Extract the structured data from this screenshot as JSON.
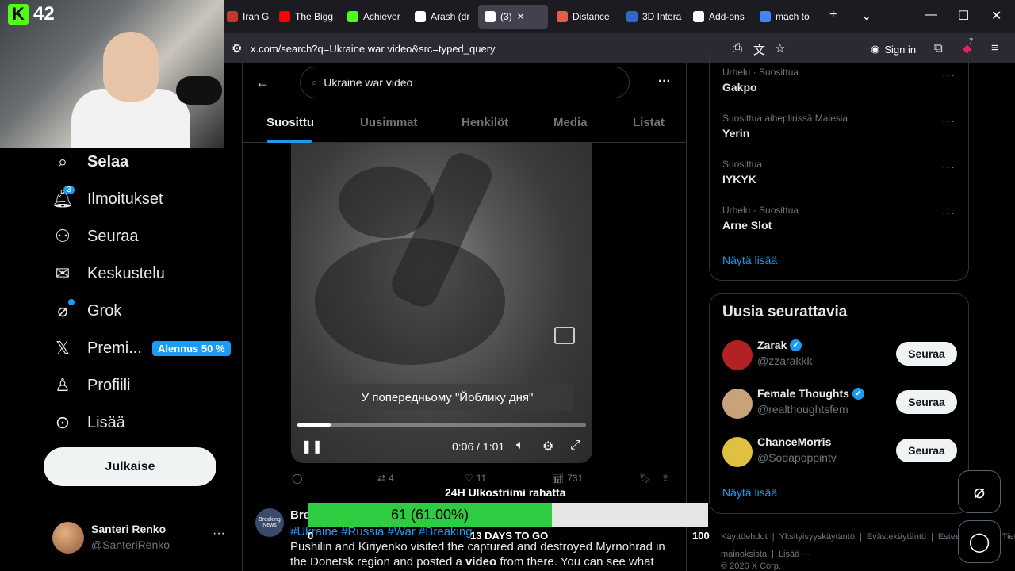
{
  "browser": {
    "tabs": [
      {
        "label": "Iran Guar",
        "color": "#c0392b"
      },
      {
        "label": "The Bigg",
        "color": "#ff0000"
      },
      {
        "label": "Achiever",
        "color": "#53fc18"
      },
      {
        "label": "Arash (dr",
        "color": "#ffffff"
      },
      {
        "label": "(3)",
        "color": "#ffffff"
      },
      {
        "label": "Distance",
        "color": "#e55b4d"
      },
      {
        "label": "3D Intera",
        "color": "#3366cc"
      },
      {
        "label": "Add-ons",
        "color": "#fbfbfe"
      },
      {
        "label": "mach to",
        "color": "#4285f4"
      }
    ],
    "url": "x.com/search?q=Ukraine war video&src=typed_query",
    "sign_in": "Sign in",
    "extension_badge": "7"
  },
  "stream": {
    "viewer_count": "42",
    "kick_letter": "K"
  },
  "nav": {
    "items": [
      {
        "label": "Selaa",
        "icon": "search-icon"
      },
      {
        "label": "Ilmoitukset",
        "icon": "bell-icon",
        "badge": "3"
      },
      {
        "label": "Seuraa",
        "icon": "add-person-icon"
      },
      {
        "label": "Keskustelu",
        "icon": "mail-icon"
      },
      {
        "label": "Grok",
        "icon": "grok-icon"
      },
      {
        "label": "Premi...",
        "icon": "x-logo-icon"
      },
      {
        "label": "Profiili",
        "icon": "person-icon"
      },
      {
        "label": "Lisää",
        "icon": "more-circle-icon"
      }
    ],
    "discount_badge": "Alennus 50 %",
    "post_button": "Julkaise",
    "account": {
      "name": "Santeri Renko",
      "handle": "@SanteriRenko"
    }
  },
  "search": {
    "query": "Ukraine war video",
    "tabs": [
      "Suosittu",
      "Uusimmat",
      "Henkilöt",
      "Media",
      "Listat"
    ],
    "active_tab": "Suosittu"
  },
  "video": {
    "subtitle": "У попередньому \"Йоблику дня\"",
    "time": "0:06 / 1:01",
    "progress_fraction": 0.115,
    "actions": {
      "replies": "",
      "reposts": "4",
      "likes": "11",
      "views": "731"
    }
  },
  "tweet2": {
    "avatar_text": "Breaking News",
    "name": "Bre",
    "tags": "#Ukraine #Russia #War #Breaking",
    "body_prefix": "Pushilin and Kiriyenko visited the captured and destroyed Myrnohrad in the Donetsk region and posted a ",
    "body_bold": "video",
    "body_suffix": " from there. You can see what Russia's"
  },
  "sub_goal": {
    "title": "24H Ulkostriimi rahatta",
    "value_text": "61 (61.00%)",
    "fraction": 0.61,
    "min": "0",
    "max": "100",
    "days": "13 DAYS TO GO"
  },
  "trends": [
    {
      "meta": "Urhelu · Suosittua",
      "name": "Gakpo"
    },
    {
      "meta": "Suosittua aiheplirissä Malesia",
      "name": "Yerin"
    },
    {
      "meta": "Suosittua",
      "name": "IYKYK"
    },
    {
      "meta": "Urhelu · Suosittua",
      "name": "Arne Slot"
    }
  ],
  "trends_show_more": "Näytä lisää",
  "who_to_follow": {
    "title": "Uusia seurattavia",
    "follow_label": "Seuraa",
    "users": [
      {
        "name": "Zarak",
        "handle": "@zzarakkk",
        "verified": true,
        "avatar_color": "#b22222"
      },
      {
        "name": "Female Thoughts",
        "handle": "@realthoughtsfem",
        "verified": true,
        "avatar_color": "#c8a27a"
      },
      {
        "name": "ChanceMorris",
        "handle": "@Sodapoppintv",
        "verified": false,
        "avatar_color": "#e0c040"
      }
    ],
    "show_more": "Näytä lisää"
  },
  "footer": {
    "links": [
      "Käyttöehdot",
      "|",
      "Yksityisyyskäytäntö",
      "|",
      "Evästekäytäntö",
      "|",
      "Esteettömyys",
      "|",
      "Tietoa mainoksista",
      "|",
      "Lisää ···"
    ],
    "copyright": "© 2026 X Corp."
  }
}
